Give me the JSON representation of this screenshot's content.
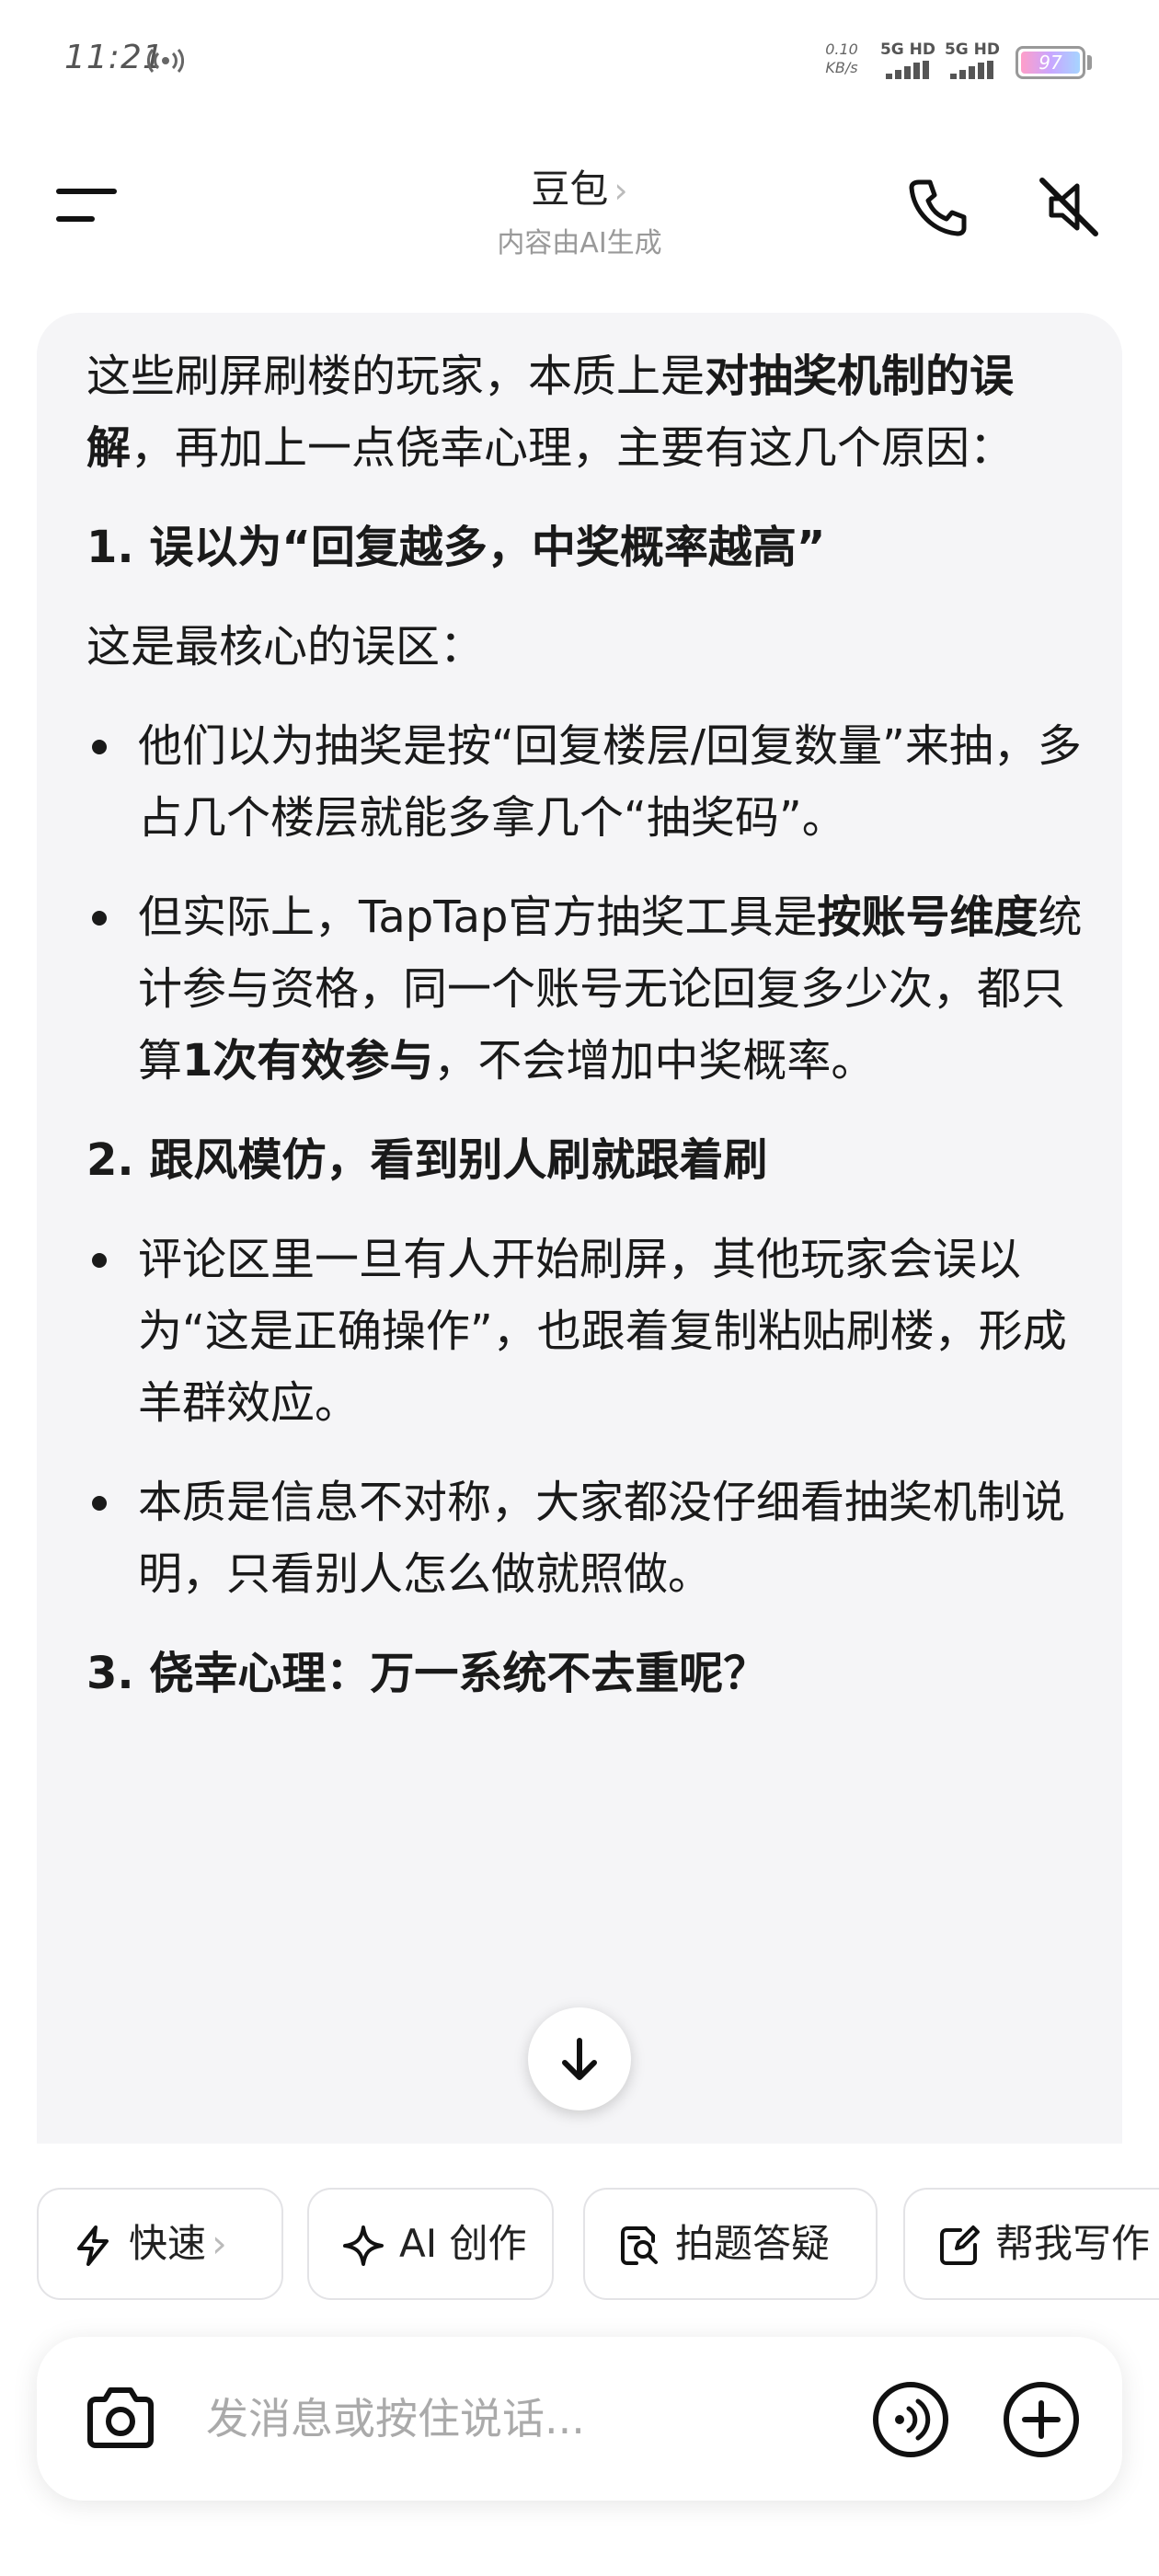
{
  "status": {
    "time": "11:21",
    "speed_value": "0.10",
    "speed_unit": "KB/s",
    "network_1": "5G HD",
    "network_2": "5G HD",
    "battery": "97"
  },
  "header": {
    "title": "豆包",
    "subtitle": "内容由AI生成"
  },
  "message": {
    "intro": {
      "text_1": "这些刷屏刷楼的玩家，本质上是",
      "bold_1": "对抽奖机制的误解",
      "text_2": "，再加上一点侥幸心理，主要有这几个原因："
    },
    "section_1": {
      "heading": "1. 误以为“回复越多，中奖概率越高”",
      "lead": "这是最核心的误区：",
      "bullet_1": "他们以为抽奖是按“回复楼层/回复数量”来抽，多占几个楼层就能多拿几个“抽奖码”。",
      "bullet_2": {
        "text_1": "但实际上，TapTap官方抽奖工具是",
        "bold_1": "按账号维度",
        "text_2": "统计参与资格，同一个账号无论回复多少次，都只算",
        "bold_2": "1次有效参与",
        "text_3": "，不会增加中奖概率。"
      }
    },
    "section_2": {
      "heading": "2. 跟风模仿，看到别人刷就跟着刷",
      "bullet_1": "评论区里一旦有人开始刷屏，其他玩家会误以为“这是正确操作”，也跟着复制粘贴刷楼，形成羊群效应。",
      "bullet_2": "本质是信息不对称，大家都没仔细看抽奖机制说明，只看别人怎么做就照做。"
    },
    "section_3": {
      "heading": "3. 侥幸心理：万一系统不去重呢？"
    }
  },
  "chips": [
    {
      "label": "快速",
      "icon": "lightning-icon"
    },
    {
      "label": "AI 创作",
      "icon": "sparkle-icon"
    },
    {
      "label": "拍题答疑",
      "icon": "photo-search-icon"
    },
    {
      "label": "帮我写作",
      "icon": "edit-icon"
    }
  ],
  "input": {
    "placeholder": "发消息或按住说话..."
  },
  "colors": {
    "bubble_bg": "#f5f5f7",
    "text": "#1a1a1a",
    "muted": "#999999"
  }
}
